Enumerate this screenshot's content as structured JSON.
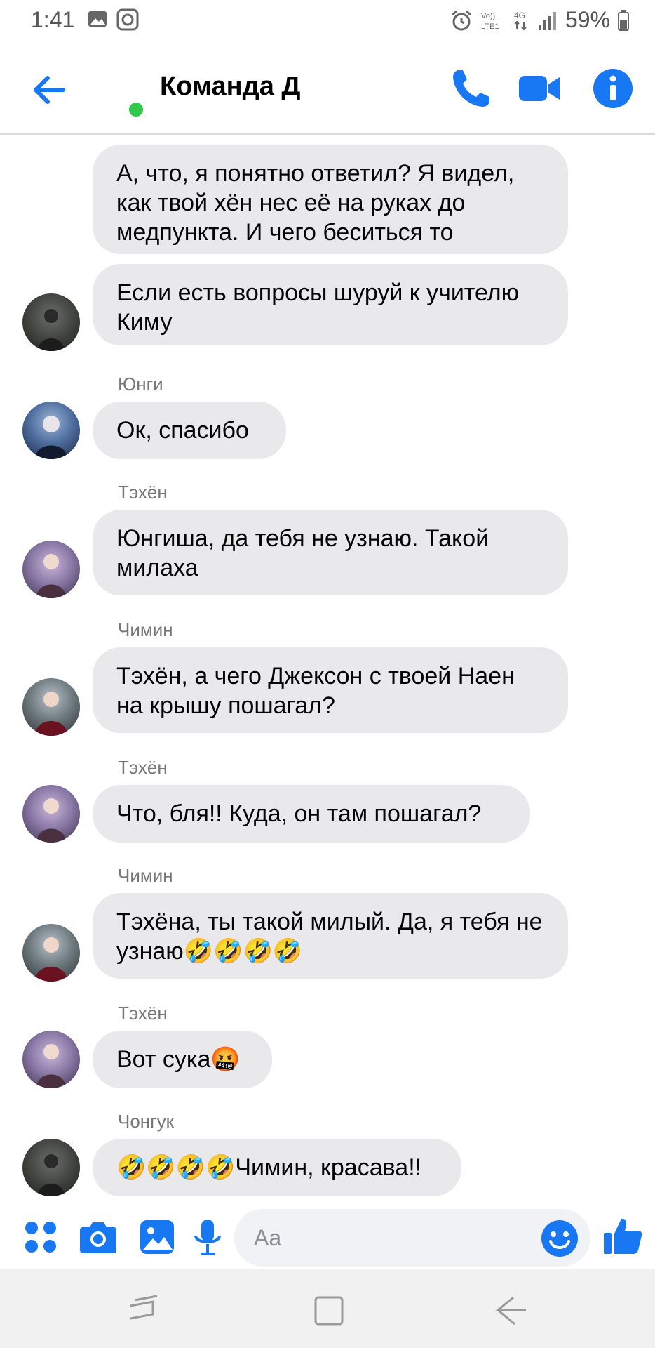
{
  "status_bar": {
    "time": "1:41",
    "battery": "59%",
    "network": "4G",
    "volte": "VoLTE1"
  },
  "header": {
    "title": "Команда Д",
    "icons": [
      "back-arrow-icon",
      "phone-icon",
      "video-icon",
      "info-icon"
    ],
    "accent": "#1877f2"
  },
  "messages": [
    {
      "sender": "",
      "text": "А, что, я понятно ответил? Я видел, как твой хён нес её на руках до медпункта. И чего беситься то"
    },
    {
      "sender": "",
      "text": "Если есть вопросы шуруй к учителю Киму"
    },
    {
      "sender": "Юнги",
      "text": "Ок, спасибо"
    },
    {
      "sender": "Тэхён",
      "text": "Юнгиша, да тебя не узнаю. Такой милаха"
    },
    {
      "sender": "Чимин",
      "text": "Тэхён, а чего Джексон с твоей Наен на крышу пошагал?"
    },
    {
      "sender": "Тэхён",
      "text": "Что, бля!! Куда, он там пошагал?"
    },
    {
      "sender": "Чимин",
      "text": "Тэхёна, ты такой милый. Да, я тебя не узнаю🤣🤣🤣🤣"
    },
    {
      "sender": "Тэхён",
      "text": "Вот сука🤬"
    },
    {
      "sender": "Чонгук",
      "text": "🤣🤣🤣🤣Чимин, красава!!"
    }
  ],
  "composer": {
    "placeholder": "Aa",
    "icons": [
      "apps-icon",
      "camera-icon",
      "gallery-icon",
      "microphone-icon",
      "emoji-icon",
      "thumbs-up-icon"
    ]
  },
  "nav_bar": {
    "icons": [
      "recent-apps-icon",
      "home-icon",
      "back-icon"
    ]
  }
}
